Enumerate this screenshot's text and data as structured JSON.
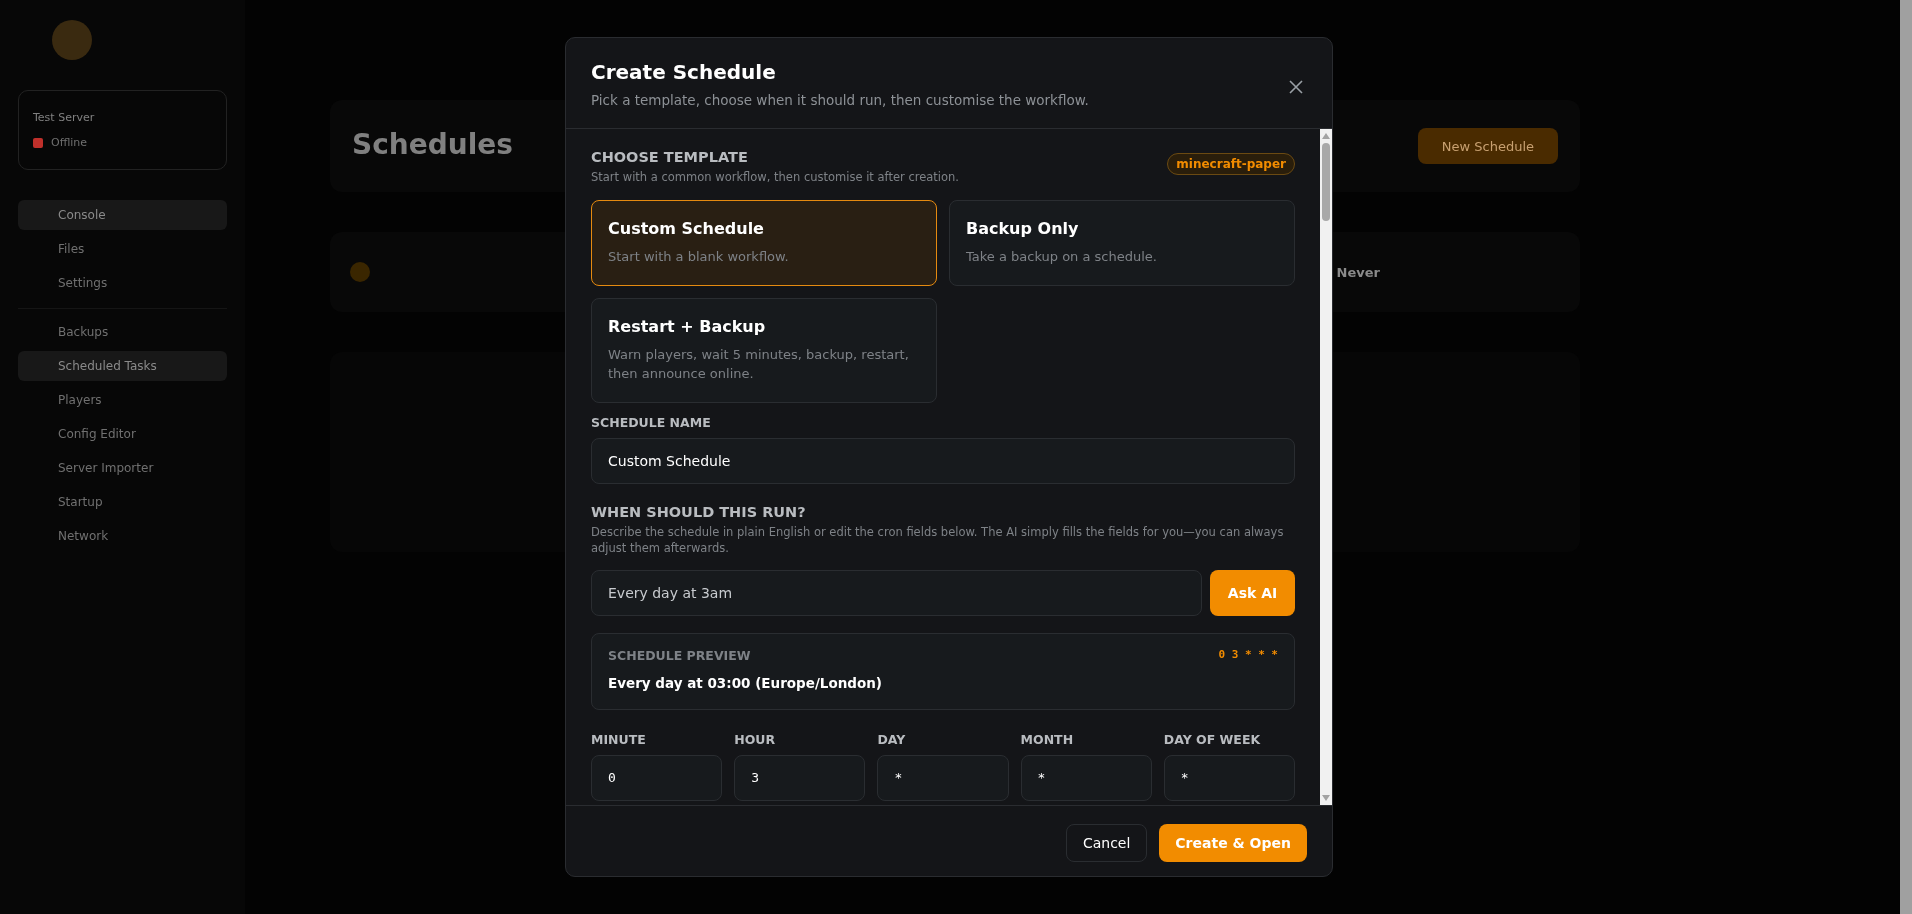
{
  "sidebar": {
    "server": {
      "name": "Test Server",
      "status": "Offline",
      "color": "#c0302b"
    },
    "items": [
      {
        "label": "Console",
        "selected": true
      },
      {
        "label": "Files",
        "selected": false
      },
      {
        "label": "Settings",
        "selected": false
      },
      {
        "label": "Backups",
        "selected": false
      },
      {
        "label": "Scheduled Tasks",
        "selected": true
      },
      {
        "label": "Players",
        "selected": false
      },
      {
        "label": "Config Editor",
        "selected": false
      },
      {
        "label": "Server Importer",
        "selected": false
      },
      {
        "label": "Startup",
        "selected": false
      },
      {
        "label": "Network",
        "selected": false
      }
    ]
  },
  "page": {
    "title": "Schedules",
    "new_button": "New Schedule",
    "stat_value": "Never"
  },
  "dialog": {
    "title": "Create Schedule",
    "subtitle": "Pick a template, choose when it should run, then customise the workflow.",
    "template_section": {
      "heading": "CHOOSE TEMPLATE",
      "hint": "Start with a common workflow, then customise it after creation.",
      "tag": "minecraft-paper"
    },
    "templates": [
      {
        "title": "Custom Schedule",
        "description": "Start with a blank workflow.",
        "selected": true
      },
      {
        "title": "Backup Only",
        "description": "Take a backup on a schedule.",
        "selected": false
      },
      {
        "title": "Restart + Backup",
        "description": "Warn players, wait 5 minutes, backup, restart, then announce online.",
        "selected": false
      }
    ],
    "name_field": {
      "label": "SCHEDULE NAME",
      "value": "Custom Schedule"
    },
    "when": {
      "heading": "WHEN SHOULD THIS RUN?",
      "hint": "Describe the schedule in plain English or edit the cron fields below. The AI simply fills the fields for you—you can always adjust them afterwards.",
      "value": "Every day at 3am",
      "button": "Ask AI"
    },
    "preview": {
      "label": "SCHEDULE PREVIEW",
      "text": "Every day at 03:00 (Europe/London)",
      "cron": "0 3 * * *"
    },
    "cron_fields": [
      {
        "label": "MINUTE",
        "value": "0"
      },
      {
        "label": "HOUR",
        "value": "3"
      },
      {
        "label": "DAY",
        "value": "*"
      },
      {
        "label": "MONTH",
        "value": "*"
      },
      {
        "label": "DAY OF WEEK",
        "value": "*"
      }
    ],
    "buttons": {
      "cancel": "Cancel",
      "confirm": "Create & Open"
    }
  }
}
